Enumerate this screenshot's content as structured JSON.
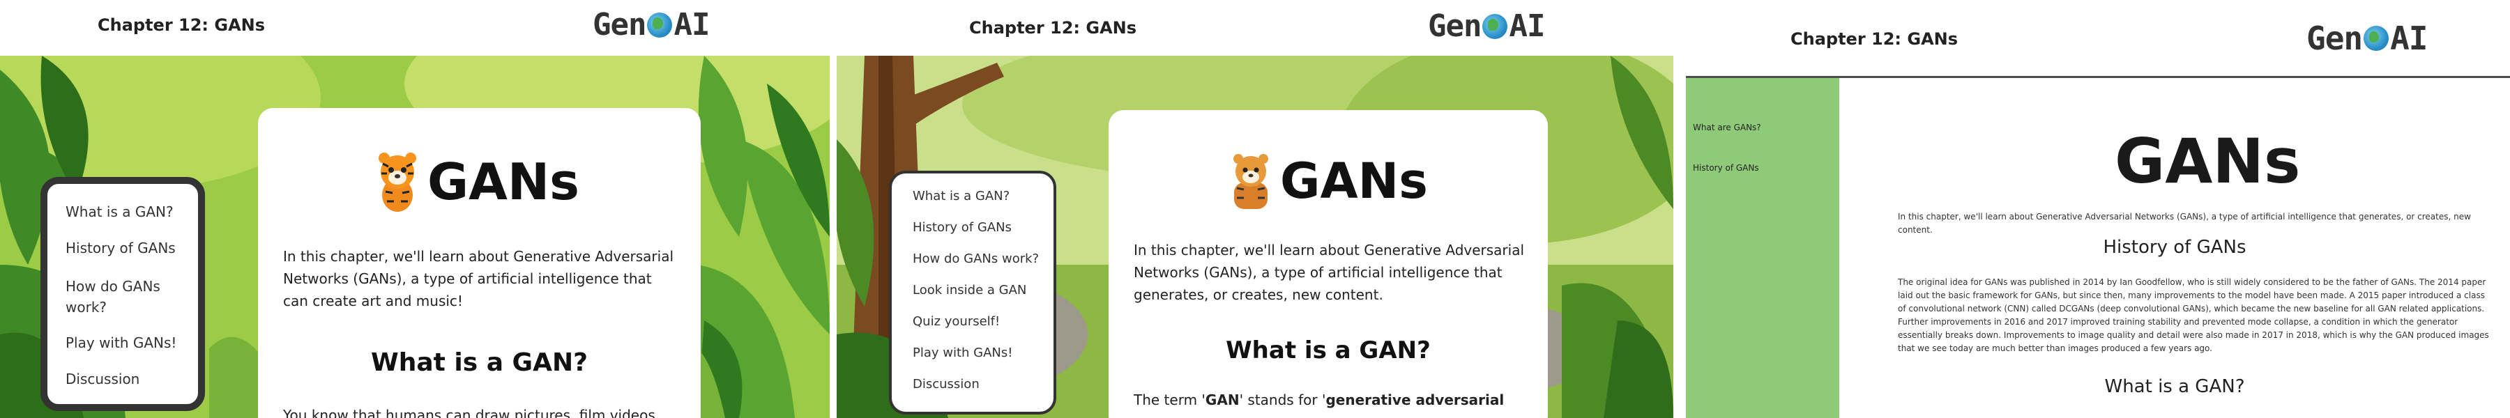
{
  "panels": [
    {
      "header": {
        "chapter": "Chapter 12: GANs",
        "logo_left": "Gen",
        "logo_right": "AI"
      },
      "page_title": "GANs",
      "intro": "In this chapter, we'll learn about Generative Adversarial Networks (GANs), a type of artificial intelligence that can create art and music!",
      "section_heading": "What is a GAN?",
      "body": "You know that humans can draw pictures, film videos,",
      "nav": [
        "What is a GAN?",
        "History of GANs",
        "How do GANs work?",
        "Play with GANs!",
        "Discussion"
      ]
    },
    {
      "header": {
        "chapter": "Chapter 12: GANs",
        "logo_left": "Gen",
        "logo_right": "AI"
      },
      "page_title": "GANs",
      "intro": "In this chapter, we'll learn about Generative Adversarial Networks (GANs), a type of artificial intelligence that generates, or creates, new content.",
      "section_heading": "What is a GAN?",
      "body_start": "The term '",
      "body_gan": "GAN",
      "body_mid": "' stands for '",
      "body_bold": "generative adversarial",
      "nav": [
        "What is a GAN?",
        "History of GANs",
        "How do GANs work?",
        "Look inside a GAN",
        "Quiz yourself!",
        "Play with GANs!",
        "Discussion"
      ]
    },
    {
      "header": {
        "chapter": "Chapter 12: GANs",
        "logo_left": "Gen",
        "logo_right": "AI"
      },
      "sidebar": [
        "What are GANs?",
        "History of GANs"
      ],
      "page_title": "GANs",
      "intro": "In this chapter, we'll learn about Generative Adversarial Networks (GANs), a type of artificial intelligence that generates, or creates, new content.",
      "history_heading": "History of GANs",
      "history_text": "The original idea for GANs was published in 2014 by Ian Goodfellow, who is still widely considered to be the father of GANs. The 2014 paper laid out the basic framework for GANs, but since then, many improvements to the model have been made. A 2015 paper introduced a class of convolutional network (CNN) called DCGANs (deep convolutional GANs), which became the new baseline for all GAN related applications. Further improvements in 2016 and 2017 improved training stability and prevented mode collapse, a condition in which the generator essentially breaks down. Improvements to image quality and detail were also made in 2017 in 2018, which is why the GAN produced images that we see today are much better than images produced a few years ago.",
      "section_heading": "What is a GAN?"
    }
  ],
  "colors": {
    "jungle_light": "#a6cc47",
    "jungle_mid": "#6aa831",
    "jungle_dark": "#2f7a1f",
    "sidebar_green": "#8fca78",
    "card_white": "#ffffff",
    "nav_border": "#333333"
  }
}
